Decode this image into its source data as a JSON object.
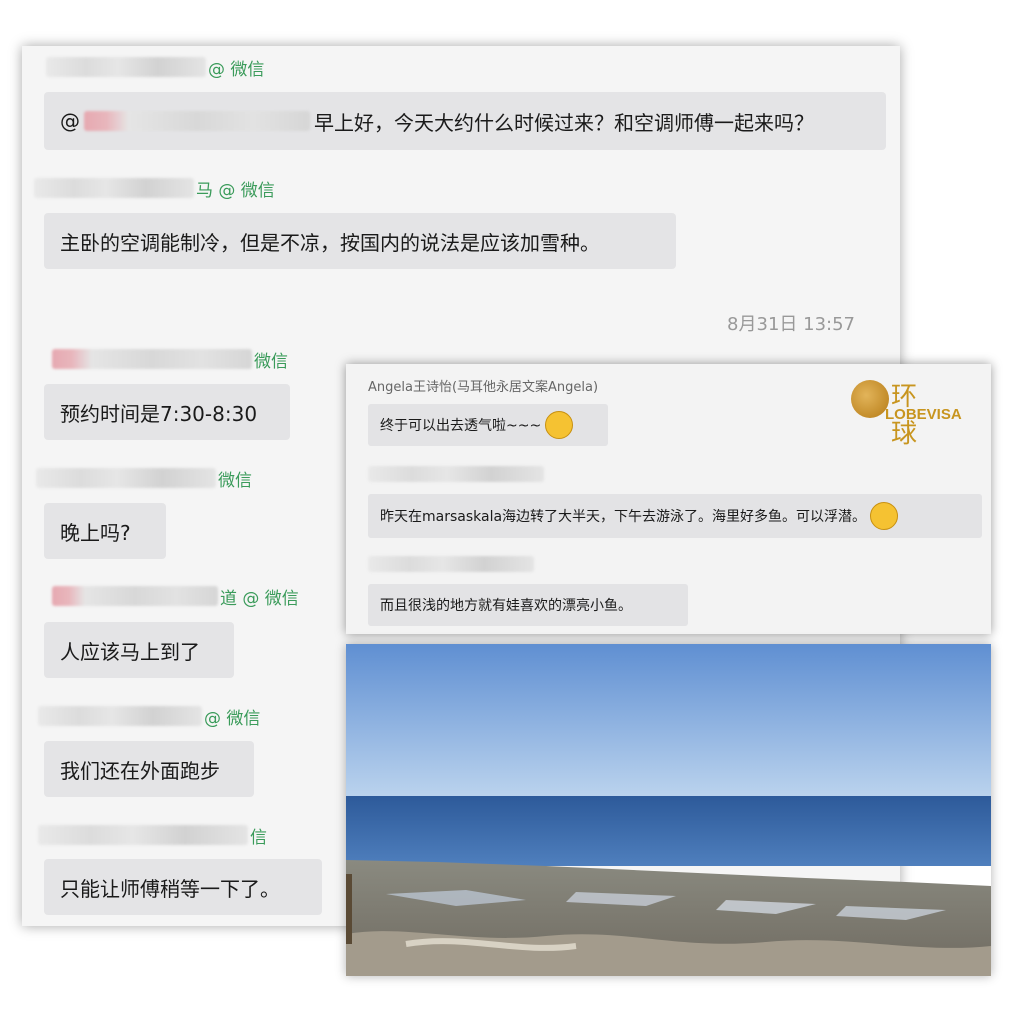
{
  "chat": {
    "messages": [
      {
        "sender_suffix": "@ 微信",
        "text": "早上好，今天大约什么时候过来？和空调师傅一起来吗？",
        "prefix": "@"
      },
      {
        "sender_suffix": "马 @ 微信",
        "text": "主卧的空调能制冷，但是不凉，按国内的说法是应该加雪种。"
      },
      {
        "sender_suffix": "微信",
        "text": "预约时间是7:30-8:30"
      },
      {
        "sender_suffix": "微信",
        "text": "晚上吗?"
      },
      {
        "sender_suffix": "道 @ 微信",
        "text": "人应该马上到了"
      },
      {
        "sender_suffix": "@ 微信",
        "text": "我们还在外面跑步"
      },
      {
        "sender_suffix": "信",
        "text": "只能让师傅稍等一下了。"
      }
    ],
    "timestamp": "8月31日 13:57"
  },
  "overlay": {
    "name": "Angela王诗怡(马耳他永居文案Angela)",
    "messages": [
      "终于可以出去透气啦~~~",
      "昨天在marsaskala海边转了大半天，下午去游泳了。海里好多鱼。可以浮潜。",
      "而且很浅的地方就有娃喜欢的漂亮小鱼。"
    ],
    "logo_cn": "环 球",
    "logo_en": "LOBEVISA"
  },
  "colors": {
    "tag_green": "#3a9b5a",
    "logo_gold": "#c8951f",
    "bubble": "#e4e4e6"
  }
}
